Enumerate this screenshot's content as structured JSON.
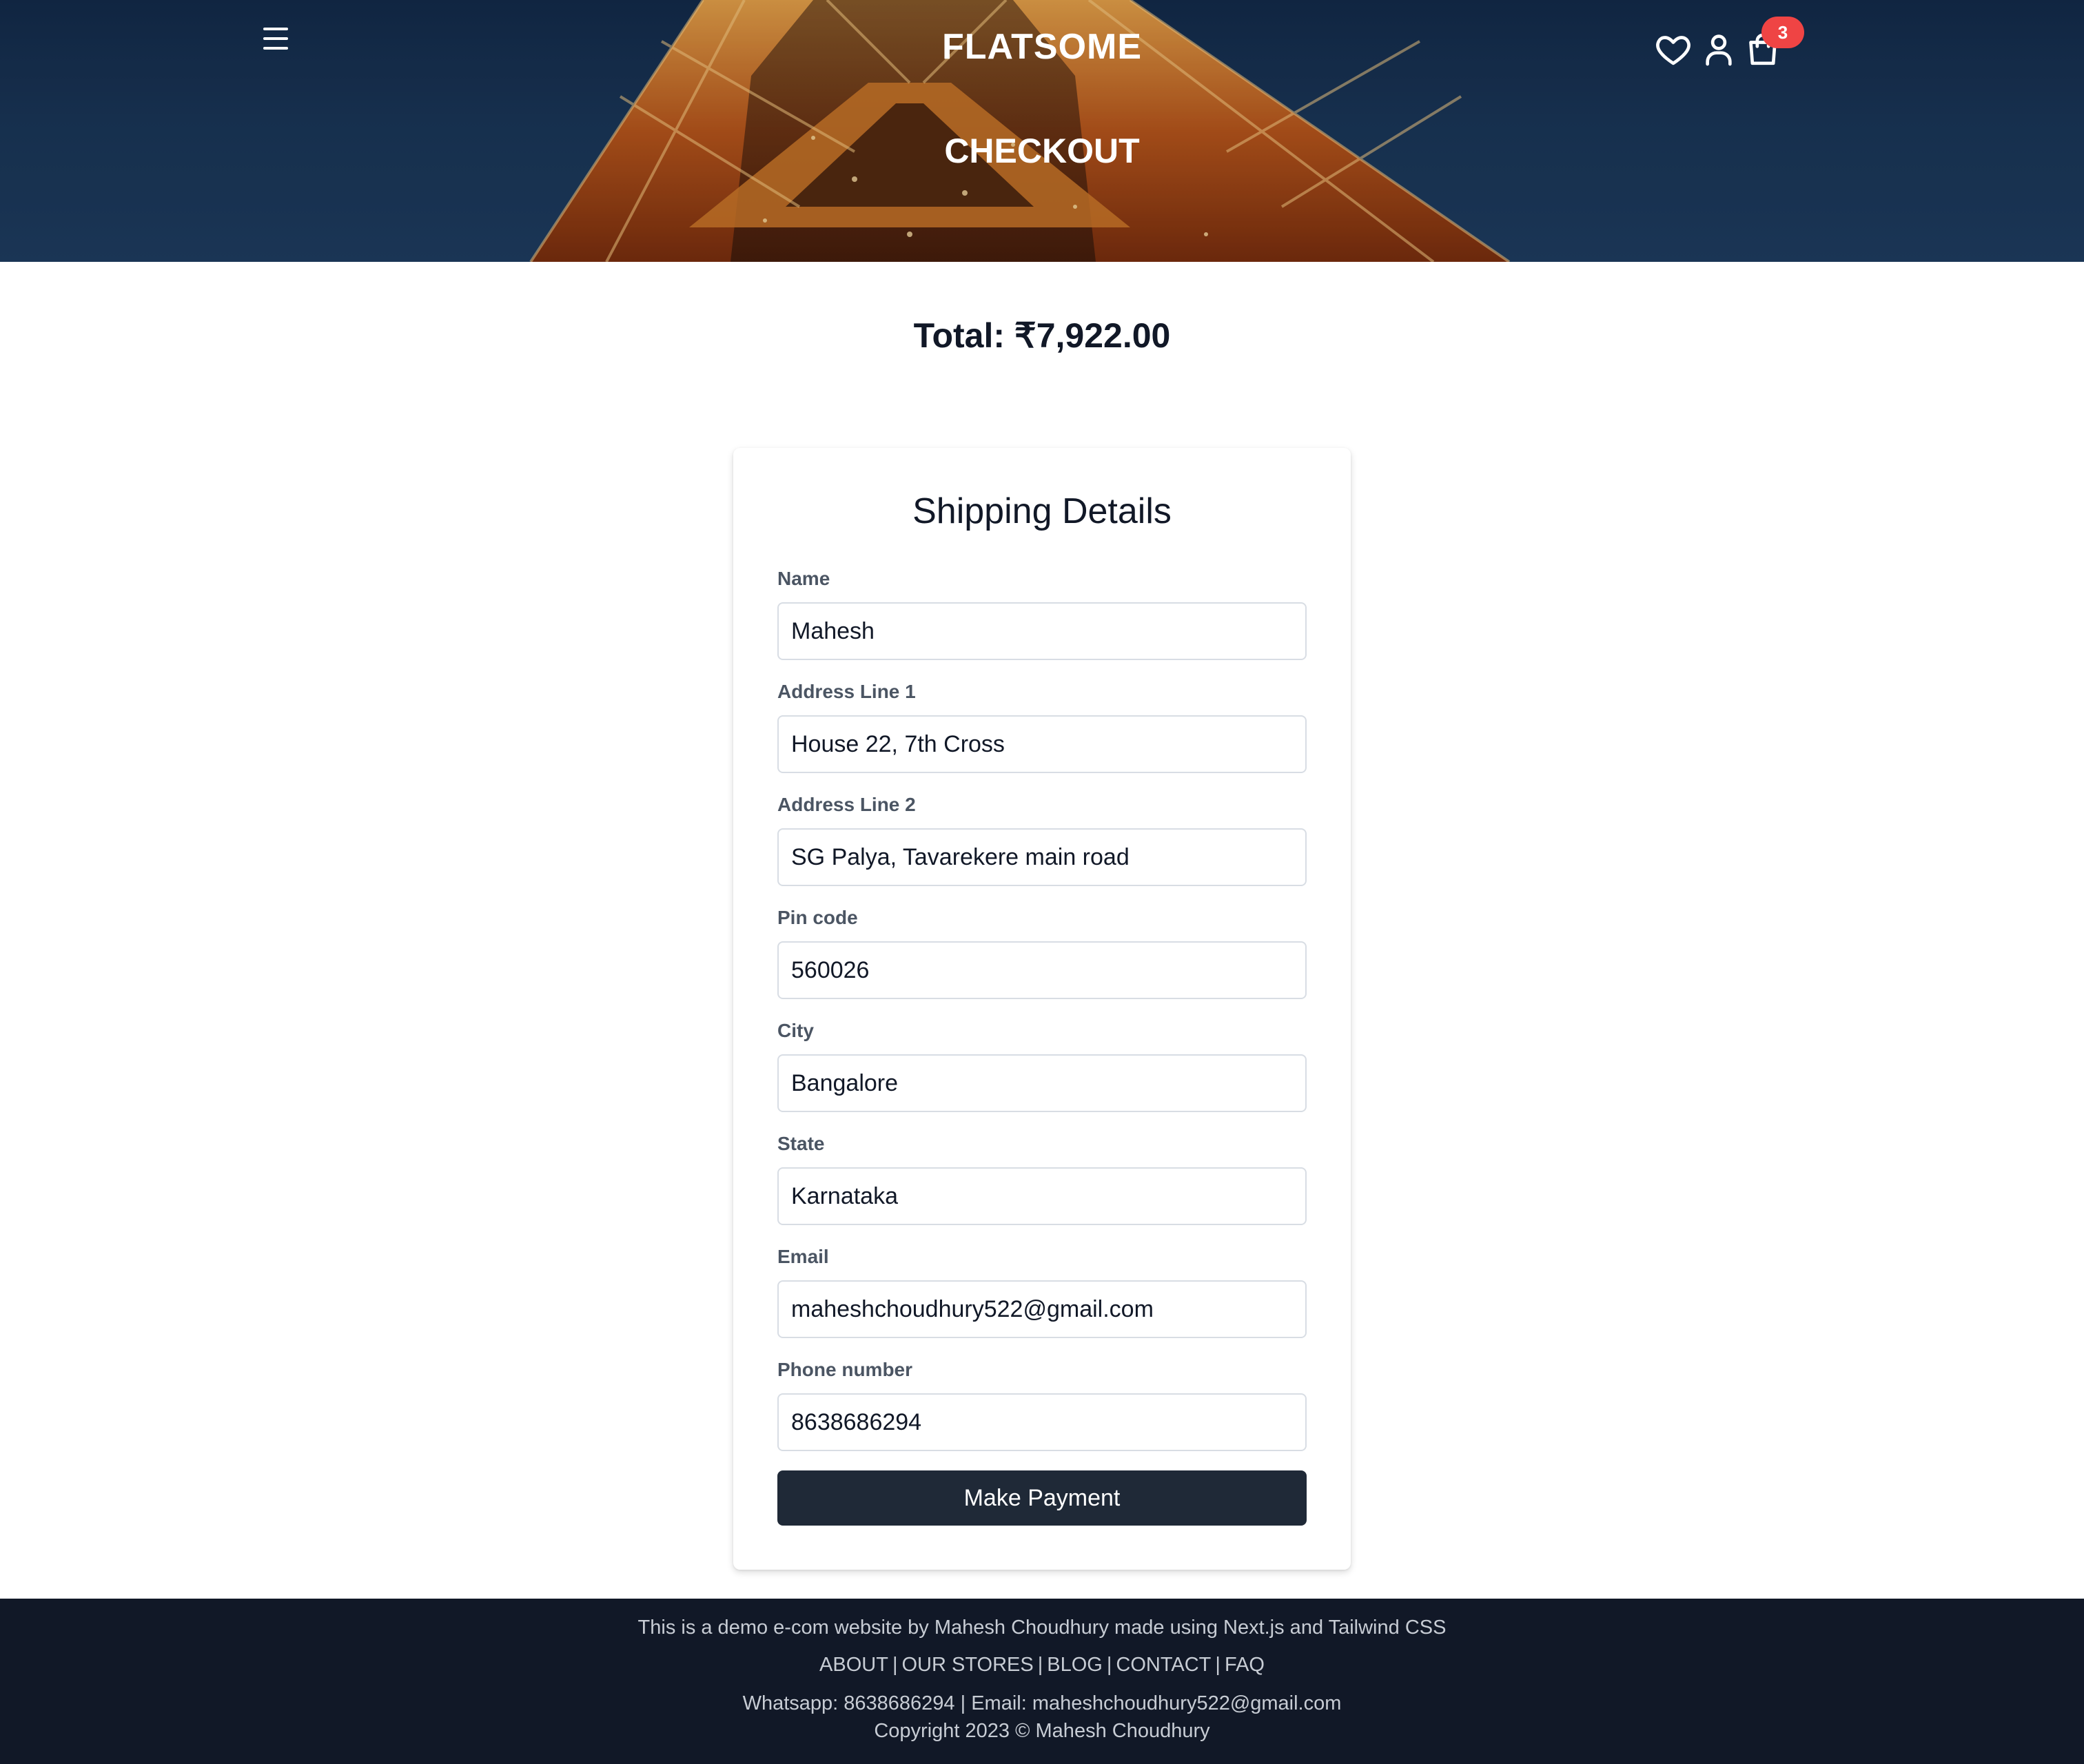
{
  "header": {
    "logo": "FLATSOME",
    "title": "CHECKOUT",
    "menu_icon": "hamburger-menu-icon",
    "wishlist_icon": "heart-icon",
    "account_icon": "user-icon",
    "cart_icon": "shopping-bag-icon",
    "cart_count": "3"
  },
  "checkout": {
    "total": "Total: ₹7,922.00"
  },
  "form": {
    "title": "Shipping Details",
    "fields": [
      {
        "label": "Name",
        "value": "Mahesh"
      },
      {
        "label": "Address Line 1",
        "value": "House 22, 7th Cross"
      },
      {
        "label": "Address Line 2",
        "value": "SG Palya, Tavarekere main road"
      },
      {
        "label": "Pin code",
        "value": "560026"
      },
      {
        "label": "City",
        "value": "Bangalore"
      },
      {
        "label": "State",
        "value": "Karnataka"
      },
      {
        "label": "Email",
        "value": "maheshchoudhury522@gmail.com"
      },
      {
        "label": "Phone number",
        "value": "8638686294"
      }
    ],
    "submit_label": "Make Payment"
  },
  "footer": {
    "tagline": "This is a demo e-com website by Mahesh Choudhury made using Next.js and Tailwind CSS",
    "links": [
      "ABOUT",
      "OUR STORES",
      "BLOG",
      "CONTACT",
      "FAQ"
    ],
    "separator": "|",
    "contact": "Whatsapp: 8638686294 | Email: maheshchoudhury522@gmail.com",
    "copyright": "Copyright 2023 © Mahesh Choudhury"
  },
  "colors": {
    "hero_sky": "#1a3658",
    "badge": "#ef4444",
    "button": "#1f2937",
    "footer_bg": "#111827"
  }
}
